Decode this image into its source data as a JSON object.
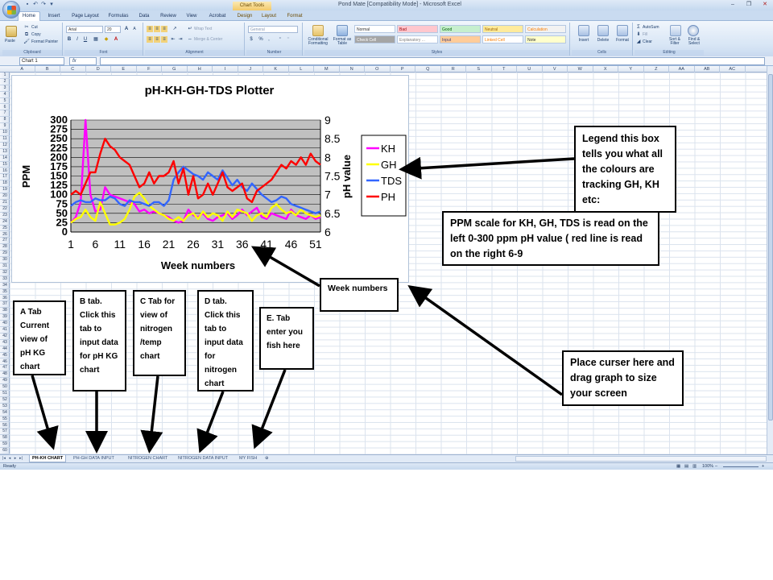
{
  "window": {
    "title": "Pond Mate  [Compatibility Mode] - Microsoft Excel",
    "chart_tools_label": "Chart Tools",
    "controls": [
      "–",
      "❐",
      "✕"
    ]
  },
  "ribbon": {
    "tabs": [
      {
        "label": "Home",
        "active": true
      },
      {
        "label": "Insert"
      },
      {
        "label": "Page Layout"
      },
      {
        "label": "Formulas"
      },
      {
        "label": "Data"
      },
      {
        "label": "Review"
      },
      {
        "label": "View"
      },
      {
        "label": "Acrobat"
      },
      {
        "label": "Design",
        "tool": true
      },
      {
        "label": "Layout",
        "tool": true
      },
      {
        "label": "Format",
        "tool": true
      }
    ],
    "clipboard": {
      "group": "Clipboard",
      "paste": "Paste",
      "cut": "Cut",
      "copy": "Copy",
      "format_painter": "Format Painter"
    },
    "font": {
      "group": "Font",
      "font_name": "Arial",
      "font_size": "20",
      "bold": "B",
      "italic": "I",
      "underline": "U"
    },
    "alignment": {
      "group": "Alignment",
      "wrap_text": "Wrap Text",
      "merge_center": "Merge & Center"
    },
    "number": {
      "group": "Number",
      "format": "General",
      "percent": "%",
      "comma": ","
    },
    "styles": {
      "group": "Styles",
      "conditional_formatting": "Conditional Formatting",
      "format_as_table": "Format as Table",
      "cells": [
        {
          "label": "Normal",
          "bg": "#ffffff",
          "fg": "#333333"
        },
        {
          "label": "Bad",
          "bg": "#ffc7ce",
          "fg": "#9c0006"
        },
        {
          "label": "Good",
          "bg": "#c6efce",
          "fg": "#006100"
        },
        {
          "label": "Neutral",
          "bg": "#ffeb9c",
          "fg": "#9c6500"
        },
        {
          "label": "Calculation",
          "bg": "#f2f2f2",
          "fg": "#fa7d00"
        },
        {
          "label": "Check Cell",
          "bg": "#a5a5a5",
          "fg": "#ffffff"
        },
        {
          "label": "Explanatory ...",
          "bg": "#ffffff",
          "fg": "#7f7f7f"
        },
        {
          "label": "Input",
          "bg": "#ffcc99",
          "fg": "#3f3f76"
        },
        {
          "label": "Linked Cell",
          "bg": "#ffffff",
          "fg": "#fa7d00"
        },
        {
          "label": "Note",
          "bg": "#ffffcc",
          "fg": "#333333"
        }
      ]
    },
    "cells": {
      "group": "Cells",
      "insert": "Insert",
      "delete": "Delete",
      "format": "Format"
    },
    "editing": {
      "group": "Editing",
      "autosum": "AutoSum",
      "fill": "Fill",
      "clear": "Clear",
      "sort_filter": "Sort & Filter",
      "find_select": "Find & Select"
    }
  },
  "formula_bar": {
    "name_box": "Chart 1",
    "fx": "fx",
    "formula": ""
  },
  "grid": {
    "columns": [
      "A",
      "B",
      "C",
      "D",
      "E",
      "F",
      "G",
      "H",
      "I",
      "J",
      "K",
      "L",
      "M",
      "N",
      "O",
      "P",
      "Q",
      "R",
      "S",
      "T",
      "U",
      "V",
      "W",
      "X",
      "Y",
      "Z",
      "AA",
      "AB",
      "AC"
    ],
    "rows": 60
  },
  "sheets": {
    "tabs": [
      "PH-KH CHART",
      "PH-GH DATA INPUT",
      "NITROGEN  CHART",
      "NITROGEN DATA INPUT",
      "MY FISH"
    ],
    "active": 0
  },
  "status": {
    "ready": "Ready",
    "zoom": "100%",
    "zoom_out": "–",
    "zoom_in": "+"
  },
  "chart_data": {
    "type": "line",
    "title": "pH-KH-GH-TDS  Plotter",
    "xlabel": "Week numbers",
    "ylabel": "PPM",
    "y2label": "pH value",
    "xticks": [
      1,
      6,
      11,
      16,
      21,
      26,
      31,
      36,
      41,
      46,
      51
    ],
    "yticks": [
      0,
      25,
      50,
      75,
      100,
      125,
      150,
      175,
      200,
      225,
      250,
      275,
      300
    ],
    "y2ticks": [
      6,
      6.5,
      7,
      7.5,
      8,
      8.5,
      9
    ],
    "xlim": [
      1,
      52
    ],
    "ylim": [
      0,
      300
    ],
    "y2lim": [
      6,
      9
    ],
    "grid": true,
    "legend_position": "right",
    "series": [
      {
        "name": "KH",
        "color": "#ff00ff",
        "axis": "left",
        "values": [
          25,
          40,
          80,
          300,
          100,
          55,
          60,
          120,
          100,
          95,
          90,
          85,
          80,
          75,
          55,
          60,
          50,
          55,
          50,
          45,
          40,
          30,
          25,
          30,
          60,
          45,
          40,
          50,
          35,
          30,
          40,
          45,
          50,
          35,
          45,
          60,
          45,
          55,
          65,
          40,
          35,
          50,
          45,
          40,
          35,
          60,
          45,
          40,
          35,
          45,
          35,
          40
        ]
      },
      {
        "name": "GH",
        "color": "#ffff00",
        "axis": "left",
        "values": [
          25,
          35,
          40,
          60,
          40,
          30,
          80,
          50,
          20,
          20,
          25,
          35,
          60,
          95,
          105,
          90,
          70,
          60,
          50,
          45,
          35,
          30,
          40,
          30,
          45,
          50,
          35,
          55,
          40,
          50,
          45,
          30,
          55,
          40,
          60,
          55,
          50,
          30,
          45,
          50,
          40,
          65,
          75,
          60,
          50,
          55,
          45,
          60,
          50,
          45,
          40,
          45
        ]
      },
      {
        "name": "TDS",
        "color": "#3366ff",
        "axis": "left",
        "values": [
          70,
          80,
          85,
          80,
          80,
          90,
          85,
          85,
          95,
          90,
          75,
          70,
          85,
          80,
          80,
          75,
          70,
          80,
          80,
          70,
          85,
          140,
          160,
          175,
          165,
          155,
          150,
          140,
          160,
          150,
          140,
          165,
          145,
          125,
          140,
          120,
          110,
          130,
          115,
          100,
          90,
          80,
          85,
          95,
          90,
          75,
          70,
          65,
          60,
          55,
          50,
          55
        ]
      },
      {
        "name": "PH",
        "color": "#ff0000",
        "axis": "right",
        "values": [
          7.0,
          7.1,
          7.0,
          7.3,
          7.6,
          7.6,
          8.1,
          8.5,
          8.3,
          8.2,
          8.0,
          7.9,
          7.8,
          7.5,
          7.2,
          7.3,
          7.6,
          7.3,
          7.5,
          7.5,
          7.6,
          7.9,
          7.3,
          7.7,
          7.0,
          7.5,
          6.9,
          7.0,
          7.3,
          7.0,
          7.3,
          7.6,
          7.2,
          7.1,
          7.2,
          7.3,
          6.9,
          6.8,
          7.1,
          7.2,
          7.3,
          7.4,
          7.6,
          7.8,
          7.7,
          7.9,
          7.8,
          8.0,
          7.8,
          8.1,
          7.9,
          7.8
        ]
      }
    ]
  },
  "callouts": {
    "legend_note": "Legend this box tells you what all the colours are tracking GH, KH etc:",
    "ppm_note": "PPM scale for KH, GH, TDS is read on the left 0-300 ppm  pH value ( red line is read on the right 6-9",
    "week_note": "Week numbers",
    "resize_note": "Place curser here and drag graph  to size  your screen",
    "tab_a": "A Tab Current view of pH KG chart",
    "tab_b": "B tab. Click this tab to input data for pH KG chart",
    "tab_c": "C Tab for view of nitrogen /temp chart",
    "tab_d": "D tab. Click this tab to input data for nitrogen chart",
    "tab_e": "E. Tab enter you fish here"
  }
}
